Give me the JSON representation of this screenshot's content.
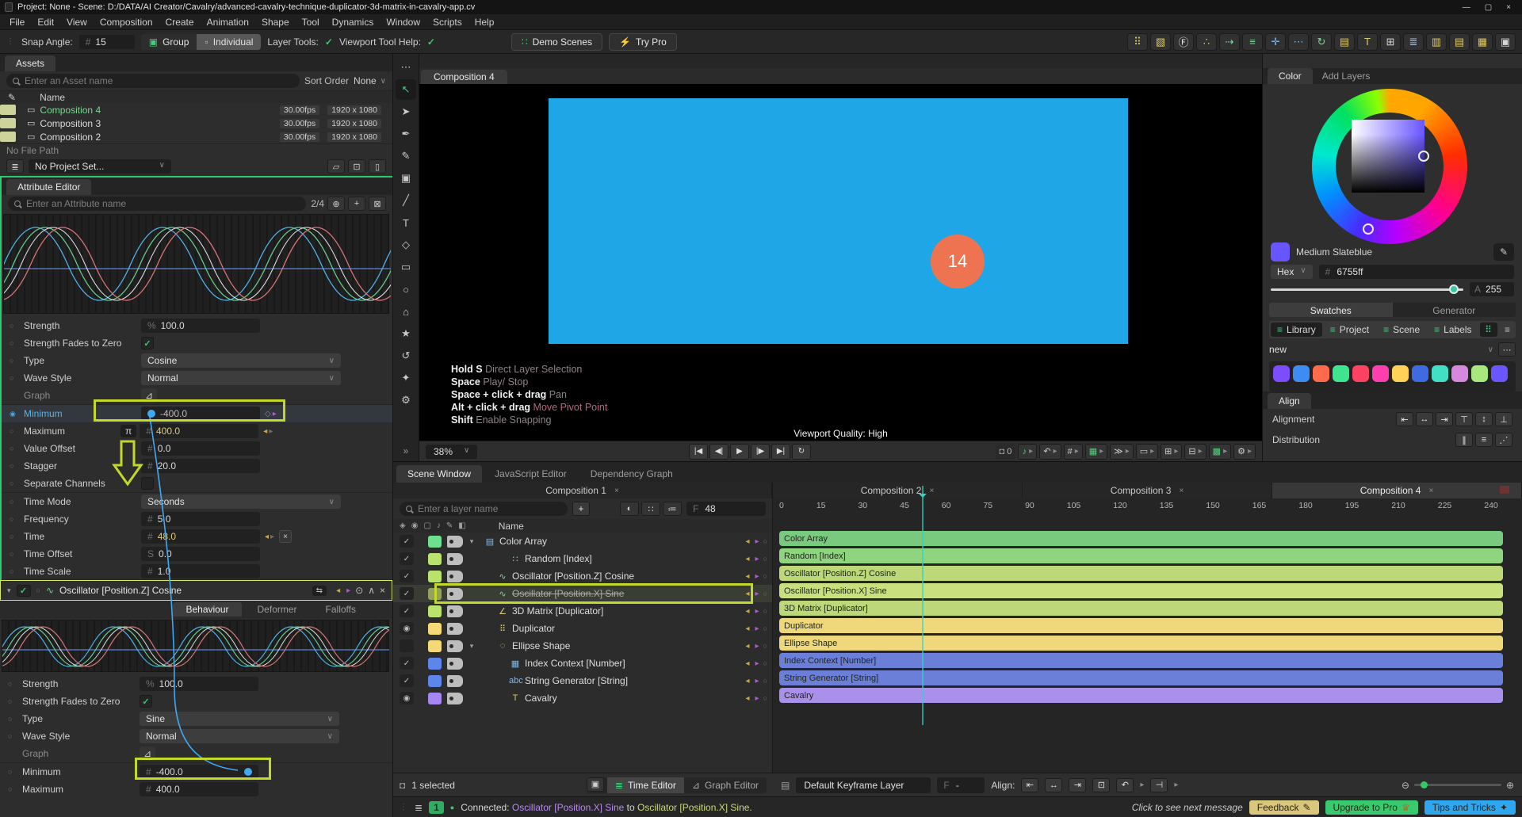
{
  "window": {
    "title": "Project: None - Scene: D:/DATA/AI Creator/Cavalry/advanced-cavalry-technique-duplicator-3d-matrix-in-cavalry-app.cv",
    "minimize": "—",
    "maximize": "▢",
    "close": "×"
  },
  "menu": {
    "items": [
      "File",
      "Edit",
      "View",
      "Composition",
      "Create",
      "Animation",
      "Shape",
      "Tool",
      "Dynamics",
      "Window",
      "Scripts",
      "Help"
    ]
  },
  "ui": {
    "check": "✓",
    "chev": "∨",
    "caret": "▾",
    "close": "×",
    "prev": "◂",
    "next": "▸",
    "circle": "○",
    "diamond": "◇",
    "ellipsis": "⋯",
    "expand": "»",
    "pi": "π",
    "pin": "⊙",
    "collapse": "∧",
    "io": "⇆",
    "wave": "∿",
    "radio": "○",
    "plus": "+",
    "hash": "#"
  },
  "toolbar": {
    "snap_angle_label": "Snap Angle:",
    "snap_angle_value": "15",
    "group_label": "Group",
    "individual_label": "Individual",
    "layer_tools_label": "Layer Tools:",
    "viewport_help_label": "Viewport Tool Help:",
    "demo_scenes_label": "Demo Scenes",
    "demo_icon": "∷",
    "try_pro_label": "Try Pro",
    "try_pro_icon": "⚡",
    "icons": [
      {
        "name": "grid-dots-icon",
        "glyph": "⠿",
        "color": "#dcc96e"
      },
      {
        "name": "cube-icon",
        "glyph": "▧",
        "color": "#dcc96e"
      },
      {
        "name": "frame-f-icon",
        "glyph": "Ⓕ",
        "color": "#e8e8e8"
      },
      {
        "name": "scatter-icon",
        "glyph": "∴",
        "color": "#dcc96e"
      },
      {
        "name": "trail-arrow-icon",
        "glyph": "⇢",
        "color": "#7fd89a"
      },
      {
        "name": "align-bars-icon",
        "glyph": "≡",
        "color": "#7fd89a"
      },
      {
        "name": "add-points-icon",
        "glyph": "✛",
        "color": "#7fb7e8"
      },
      {
        "name": "dots-icon",
        "glyph": "⋯",
        "color": "#7fb7e8"
      },
      {
        "name": "arc-icon",
        "glyph": "↻",
        "color": "#7fd89a"
      },
      {
        "name": "filmstrip-icon",
        "glyph": "▤",
        "color": "#dcc96e"
      },
      {
        "name": "trace-icon",
        "glyph": "T",
        "color": "#dcc96e"
      },
      {
        "name": "stagger-icon",
        "glyph": "⊞",
        "color": "#d8d8d8"
      },
      {
        "name": "cascade-icon",
        "glyph": "≣",
        "color": "#a8c8e8"
      },
      {
        "name": "columns-icon",
        "glyph": "▥",
        "color": "#dcc96e"
      },
      {
        "name": "rows-icon",
        "glyph": "▤",
        "color": "#dcc96e"
      },
      {
        "name": "grid-cells-icon",
        "glyph": "▦",
        "color": "#dcc96e"
      },
      {
        "name": "camera-icon",
        "glyph": "▣",
        "color": "#d8d8d8"
      }
    ]
  },
  "assets": {
    "tab": "Assets",
    "search_placeholder": "Enter an Asset name",
    "sort_label": "Sort Order",
    "sort_value": "None",
    "name_header": "Name",
    "rows": [
      {
        "name": "Composition 4",
        "fps": "30.00fps",
        "size": "1920 x 1080",
        "selected": true
      },
      {
        "name": "Composition 3",
        "fps": "30.00fps",
        "size": "1920 x 1080"
      },
      {
        "name": "Composition 2",
        "fps": "30.00fps",
        "size": "1920 x 1080"
      }
    ],
    "file_path": "No File Path",
    "project_set": "No Project Set..."
  },
  "attribute_editor": {
    "tab": "Attribute Editor",
    "search_placeholder": "Enter an Attribute name",
    "counter": "2/4",
    "osc1": {
      "strength_label": "Strength",
      "strength_prefix": "%",
      "strength_value": "100.0",
      "fades_label": "Strength Fades to Zero",
      "type_label": "Type",
      "type_value": "Cosine",
      "wave_label": "Wave Style",
      "wave_value": "Normal",
      "graph_label": "Graph",
      "min_label": "Minimum",
      "min_value": "-400.0",
      "max_label": "Maximum",
      "max_badge": "π",
      "max_prefix": "#",
      "max_value": "400.0",
      "offset_label": "Value Offset",
      "offset_prefix": "#",
      "offset_value": "0.0",
      "stagger_label": "Stagger",
      "stagger_prefix": "#",
      "stagger_value": "20.0",
      "separate_label": "Separate Channels",
      "timemode_label": "Time Mode",
      "timemode_value": "Seconds",
      "freq_label": "Frequency",
      "freq_prefix": "#",
      "freq_value": "5.0",
      "time_label": "Time",
      "time_prefix": "#",
      "time_value": "48.0",
      "toffset_label": "Time Offset",
      "toffset_prefix": "S",
      "toffset_value": "0.0",
      "tscale_label": "Time Scale",
      "tscale_prefix": "#",
      "tscale_value": "1.0"
    },
    "osc2": {
      "header": "Oscillator [Position.Z] Cosine",
      "tabs": [
        {
          "label": "Behaviour",
          "active": true
        },
        {
          "label": "Deformer"
        },
        {
          "label": "Falloffs"
        }
      ],
      "strength_label": "Strength",
      "strength_prefix": "%",
      "strength_value": "100.0",
      "fades_label": "Strength Fades to Zero",
      "type_label": "Type",
      "type_value": "Sine",
      "wave_label": "Wave Style",
      "wave_value": "Normal",
      "graph_label": "Graph",
      "min_label": "Minimum",
      "min_prefix": "#",
      "min_value": "-400.0",
      "max_label": "Maximum",
      "max_prefix": "#",
      "max_value": "400.0"
    }
  },
  "tools": {
    "items": [
      {
        "name": "tool-menu-icon",
        "glyph": "⋯"
      },
      {
        "name": "select-tool-icon",
        "glyph": "↖",
        "active": true
      },
      {
        "name": "direct-select-tool-icon",
        "glyph": "➤"
      },
      {
        "name": "pen-tool-icon",
        "glyph": "✒"
      },
      {
        "name": "pencil-tool-icon",
        "glyph": "✎"
      },
      {
        "name": "camera-tool-icon",
        "glyph": "▣"
      },
      {
        "name": "line-tool-icon",
        "glyph": "╱"
      },
      {
        "name": "text-tool-icon",
        "glyph": "T"
      },
      {
        "name": "frame-tool-icon",
        "glyph": "◇"
      },
      {
        "name": "rectangle-tool-icon",
        "glyph": "▭"
      },
      {
        "name": "ellipse-tool-icon",
        "glyph": "○"
      },
      {
        "name": "polygon-tool-icon",
        "glyph": "⌂"
      },
      {
        "name": "star-tool-icon",
        "glyph": "★"
      },
      {
        "name": "arc-tool-icon",
        "glyph": "↺"
      },
      {
        "name": "spark-tool-icon",
        "glyph": "✦"
      },
      {
        "name": "settings-tool-icon",
        "glyph": "⚙"
      }
    ],
    "expand": "»"
  },
  "viewport": {
    "tab": "Composition 4",
    "badge": "14",
    "rect_color": "#1ea6e6",
    "circle_color": "#ee7350",
    "help": [
      {
        "key": "Hold S",
        "desc": "Direct Layer Selection"
      },
      {
        "key": "Space",
        "desc": "Play/ Stop"
      },
      {
        "key": "Space + click + drag",
        "desc": "Pan"
      },
      {
        "key": "Alt + click + drag",
        "desc": "Move Pivot Point",
        "pivot": true
      },
      {
        "key": "Shift",
        "desc": "Enable Snapping"
      }
    ],
    "quality": "Viewport Quality: High",
    "zoom": "38%",
    "counter": "0",
    "transport": [
      {
        "name": "skip-start-button",
        "glyph": "|◀"
      },
      {
        "name": "step-back-button",
        "glyph": "◀|"
      },
      {
        "name": "play-button",
        "glyph": "▶"
      },
      {
        "name": "step-forward-button",
        "glyph": "|▶"
      },
      {
        "name": "skip-end-button",
        "glyph": "▶|"
      },
      {
        "name": "loop-button",
        "glyph": "↻"
      }
    ],
    "controls": [
      {
        "name": "audio-button",
        "glyph": "♪",
        "color": "#53d07a"
      },
      {
        "name": "undo-view-button",
        "glyph": "↶",
        "color": "#cfcfcf"
      },
      {
        "name": "grid-button",
        "glyph": "#",
        "color": "#cfcfcf"
      },
      {
        "name": "panels-button",
        "glyph": "▦",
        "color": "#53d07a"
      },
      {
        "name": "speed-button",
        "glyph": "≫",
        "color": "#cfcfcf"
      },
      {
        "name": "bounds-button",
        "glyph": "▭",
        "color": "#cfcfcf"
      },
      {
        "name": "layers-button",
        "glyph": "⊞",
        "color": "#cfcfcf"
      },
      {
        "name": "duplicate-button",
        "glyph": "⊟",
        "color": "#cfcfcf"
      },
      {
        "name": "checker-button",
        "glyph": "▩",
        "color": "#53d07a"
      },
      {
        "name": "settings-button",
        "glyph": "⚙",
        "color": "#cfcfcf"
      }
    ]
  },
  "color_panel": {
    "tab_color": "Color",
    "tab_add": "Add Layers",
    "swatch_name": "Medium Slateblue",
    "accent": "#6755ff",
    "hex_label": "Hex",
    "hex_prefix": "#",
    "hex_value": "6755ff",
    "alpha_label": "A",
    "alpha_value": "255",
    "tab_swatches": "Swatches",
    "tab_generator": "Generator",
    "sources": [
      {
        "label": "Library",
        "active": true
      },
      {
        "label": "Project"
      },
      {
        "label": "Scene"
      },
      {
        "label": "Labels"
      }
    ],
    "group": "new",
    "swatches": [
      "#7c4dff",
      "#3d8bf5",
      "#ff6a4d",
      "#3ee58f",
      "#ff4263",
      "#ff3fae",
      "#ffd257",
      "#3f6be0",
      "#41e0c4",
      "#d687de",
      "#a6e87d",
      "#6a56ff"
    ]
  },
  "align_panel": {
    "tab": "Align",
    "alignment_label": "Alignment",
    "distribution_label": "Distribution",
    "alignment_icons": [
      {
        "name": "align-left-icon",
        "glyph": "⇤"
      },
      {
        "name": "align-center-h-icon",
        "glyph": "↔"
      },
      {
        "name": "align-right-icon",
        "glyph": "⇥"
      },
      {
        "name": "align-top-icon",
        "glyph": "⊤"
      },
      {
        "name": "align-middle-v-icon",
        "glyph": "↕"
      },
      {
        "name": "align-bottom-icon",
        "glyph": "⊥"
      }
    ],
    "distribution_icons": [
      {
        "name": "distribute-h-icon",
        "glyph": "∥"
      },
      {
        "name": "distribute-v-icon",
        "glyph": "≡"
      },
      {
        "name": "distribute-scatter-icon",
        "glyph": "⋰"
      }
    ]
  },
  "scene": {
    "tabs": [
      {
        "label": "Scene Window",
        "active": true
      },
      {
        "label": "JavaScript Editor"
      },
      {
        "label": "Dependency Graph"
      }
    ],
    "comp_tab": "Composition 1",
    "search_placeholder": "Enter a layer name",
    "frame_label": "F",
    "frame_value": "48",
    "name_header": "Name",
    "hdr_icons": [
      {
        "name": "lock-icon",
        "glyph": "◈"
      },
      {
        "name": "visibility-icon",
        "glyph": "◉"
      },
      {
        "name": "render-icon",
        "glyph": "▢"
      },
      {
        "name": "audio-icon",
        "glyph": "♪"
      },
      {
        "name": "picker-icon",
        "glyph": "✎"
      },
      {
        "name": "tag-icon",
        "glyph": "◧"
      }
    ],
    "filter_icons": [
      {
        "name": "solo-filter-icon",
        "glyph": "◐"
      },
      {
        "name": "add-filter-icon",
        "glyph": "∷"
      },
      {
        "name": "settings-filter-icon",
        "glyph": "≔"
      }
    ],
    "layers": [
      {
        "name": "Color Array",
        "swatch": "#6fe08e",
        "vis": "✓",
        "indent": 0,
        "icon": "▤",
        "icon_color": "#7fb7e8",
        "caret": "▾"
      },
      {
        "name": "Random [Index]",
        "swatch": "#b9e36e",
        "vis": "✓",
        "indent": 2,
        "icon": "∷",
        "icon_color": "#7fd89a",
        "caret": ""
      },
      {
        "name": "Oscillator [Position.Z] Cosine",
        "swatch": "#b9e36e",
        "vis": "✓",
        "indent": 1,
        "icon": "∿",
        "icon_color": "#7fd89a",
        "caret": ""
      },
      {
        "name": "Oscillator [Position.X] Sine",
        "swatch": "#93a35e",
        "vis": "✓",
        "indent": 1,
        "icon": "∿",
        "icon_color": "#7fd89a",
        "caret": "",
        "selected": true,
        "struck": true
      },
      {
        "name": "3D Matrix [Duplicator]",
        "swatch": "#b9e36e",
        "vis": "✓",
        "indent": 1,
        "icon": "∠",
        "icon_color": "#dcc96e",
        "caret": ""
      },
      {
        "name": "Duplicator",
        "swatch": "#f4d976",
        "vis": "◉",
        "indent": 1,
        "icon": "⠿",
        "icon_color": "#dcc96e",
        "caret": ""
      },
      {
        "name": "Ellipse Shape",
        "swatch": "#f4d976",
        "vis": "",
        "indent": 1,
        "icon": "◌",
        "icon_color": "#dcc96e",
        "caret": "▾"
      },
      {
        "name": "Index Context [Number]",
        "swatch": "#5d86ea",
        "vis": "✓",
        "indent": 2,
        "icon": "▦",
        "icon_color": "#7fb7e8",
        "caret": ""
      },
      {
        "name": "String Generator [String]",
        "swatch": "#5d86ea",
        "vis": "✓",
        "indent": 2,
        "icon": "abc",
        "icon_color": "#7fb7e8",
        "caret": ""
      },
      {
        "name": "Cavalry",
        "swatch": "#a687f2",
        "vis": "◉",
        "indent": 2,
        "icon": "T",
        "icon_color": "#dcc96e",
        "caret": ""
      }
    ],
    "selected_label": "1 selected",
    "time_editor": "Time Editor",
    "graph_editor": "Graph Editor"
  },
  "timeline": {
    "tabs": [
      {
        "label": "Composition 2"
      },
      {
        "label": "Composition 3"
      },
      {
        "label": "Composition 4",
        "active": true
      }
    ],
    "ruler": [
      "0",
      "15",
      "30",
      "45",
      "60",
      "75",
      "90",
      "105",
      "120",
      "135",
      "150",
      "165",
      "180",
      "195",
      "210",
      "225",
      "240"
    ],
    "playhead_frame": "48",
    "playhead_color": "#2bd5c8",
    "bars": [
      {
        "label": "Color Array",
        "color": "#79c97f"
      },
      {
        "label": "Random [Index]",
        "color": "#8fd47e"
      },
      {
        "label": "Oscillator [Position.Z] Cosine",
        "color": "#bcd878"
      },
      {
        "label": "Oscillator [Position.X] Sine",
        "color": "#c9e07f"
      },
      {
        "label": "3D Matrix [Duplicator]",
        "color": "#bcd878"
      },
      {
        "label": "Duplicator",
        "color": "#eed87b"
      },
      {
        "label": "Ellipse Shape",
        "color": "#eed87b"
      },
      {
        "label": "Index Context [Number]",
        "color": "#6b7fd9"
      },
      {
        "label": "String Generator [String]",
        "color": "#6b7fd9"
      },
      {
        "label": "Cavalry",
        "color": "#a990ea"
      }
    ],
    "keyframe_layer": "Default Keyframe Layer",
    "frame_label": "F",
    "frame_value": "-",
    "align_label": "Align:"
  },
  "status": {
    "badge": "1",
    "prefix": "Connected:",
    "from_name": "Oscillator [Position.X] Sine",
    "to_word": "to",
    "to_name": "Oscillator [Position.X] Sine.",
    "next_message": "Click to see next message",
    "feedback": "Feedback",
    "upgrade": "Upgrade to Pro",
    "tips": "Tips and Tricks",
    "feedback_color": "#d8c77c",
    "upgrade_color": "#39c96e",
    "tips_color": "#2fa7f0"
  }
}
